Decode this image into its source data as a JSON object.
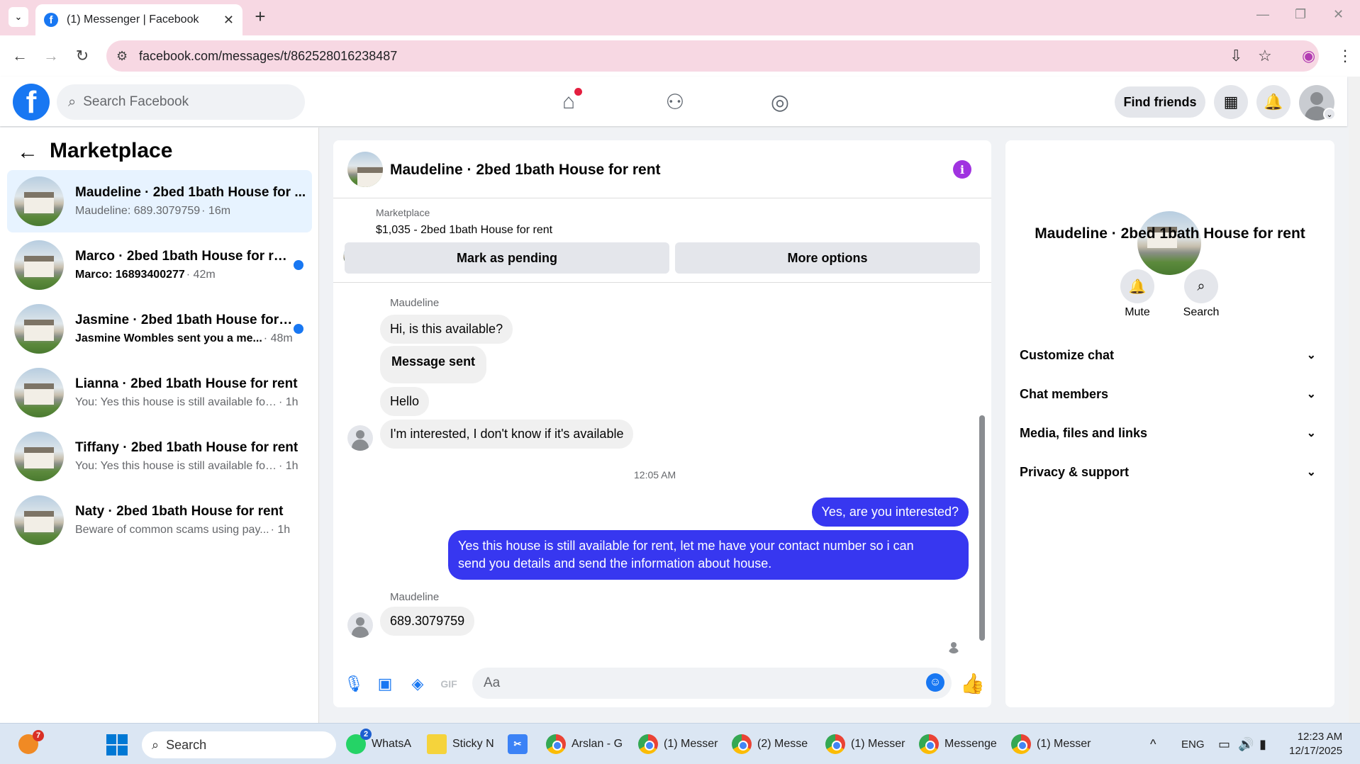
{
  "browser": {
    "tab_title": "(1) Messenger | Facebook",
    "url": "facebook.com/messages/t/862528016238487"
  },
  "fb": {
    "search_placeholder": "Search Facebook",
    "find_friends": "Find friends"
  },
  "sidebar": {
    "title": "Marketplace",
    "conversations": [
      {
        "name": "Maudeline · 2bed 1bath House for ...",
        "preview": "Maudeline: 689.3079759",
        "time": " · 16m",
        "unread": false,
        "active": true
      },
      {
        "name": "Marco · 2bed 1bath House for rent",
        "preview": "Marco: 16893400277",
        "time": " · 42m",
        "unread": true,
        "active": false
      },
      {
        "name": "Jasmine · 2bed 1bath House for r...",
        "preview": "Jasmine Wombles sent you a me...",
        "time": " · 48m",
        "unread": true,
        "active": false
      },
      {
        "name": "Lianna · 2bed 1bath House for rent",
        "preview": "You: Yes this house is still available for...",
        "time": " · 1h",
        "unread": false,
        "active": false
      },
      {
        "name": "Tiffany · 2bed 1bath House for rent",
        "preview": "You: Yes this house is still available for...",
        "time": " · 1h",
        "unread": false,
        "active": false
      },
      {
        "name": "Naty · 2bed 1bath House for rent",
        "preview": "Beware of common scams using pay...",
        "time": " · 1h",
        "unread": false,
        "active": false
      }
    ]
  },
  "chat": {
    "title": "Maudeline · 2bed 1bath House for rent",
    "listing_label": "Marketplace",
    "listing_price": "$1,035 - 2bed 1bath House for rent",
    "mark_pending": "Mark as pending",
    "more_options": "More options",
    "sender1": "Maudeline",
    "msg1": "Hi, is this available?",
    "msg2": "Message sent",
    "msg3": "Hello",
    "msg4": "I'm interested, I don't know if it's available",
    "timestamp": "12:05 AM",
    "out1": "Yes, are you interested?",
    "out2_line1": "Yes this house is still available for rent, let me have your contact number so i can",
    "out2_line2": "send you details and send the information about house.",
    "sender2": "Maudeline",
    "msg5": "689.3079759",
    "composer_placeholder": "Aa"
  },
  "info": {
    "name": "Maudeline · 2bed 1bath House for rent",
    "mute": "Mute",
    "search": "Search",
    "sections": [
      "Customize chat",
      "Chat members",
      "Media, files and links",
      "Privacy & support"
    ]
  },
  "taskbar": {
    "search": "Search",
    "apps": [
      {
        "label": "WhatsA",
        "badge": "2"
      },
      {
        "label": "Sticky N"
      },
      {
        "label": "Arslan - G"
      },
      {
        "label": "(1) Messer"
      },
      {
        "label": "(2) Messe"
      },
      {
        "label": "(1) Messer"
      },
      {
        "label": "Messenge"
      },
      {
        "label": "(1) Messer"
      }
    ],
    "weather_badge": "7",
    "lang": "ENG",
    "time": "12:23 AM",
    "date": "12/17/2025"
  },
  "colors": {
    "fb_blue": "#1877f2",
    "outgoing_bubble": "#3737f0",
    "tabstrip": "#f7d8e3"
  }
}
